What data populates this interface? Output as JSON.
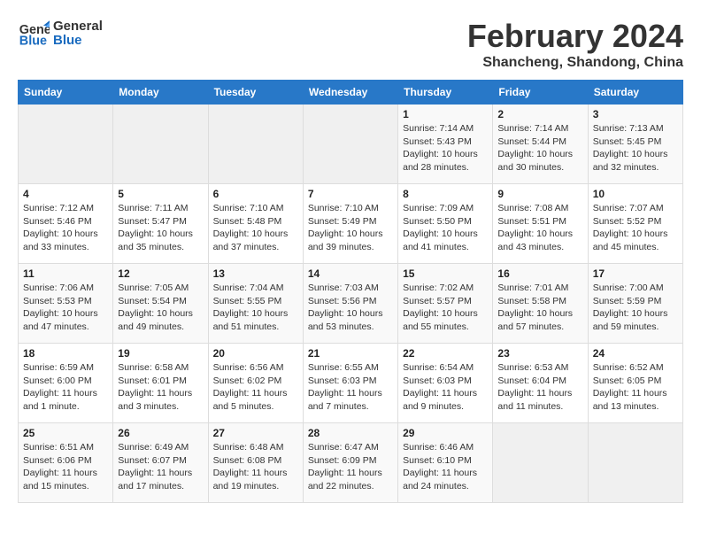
{
  "header": {
    "logo_line1": "General",
    "logo_line2": "Blue",
    "title": "February 2024",
    "subtitle": "Shancheng, Shandong, China"
  },
  "weekdays": [
    "Sunday",
    "Monday",
    "Tuesday",
    "Wednesday",
    "Thursday",
    "Friday",
    "Saturday"
  ],
  "weeks": [
    [
      {
        "day": "",
        "info": ""
      },
      {
        "day": "",
        "info": ""
      },
      {
        "day": "",
        "info": ""
      },
      {
        "day": "",
        "info": ""
      },
      {
        "day": "1",
        "info": "Sunrise: 7:14 AM\nSunset: 5:43 PM\nDaylight: 10 hours\nand 28 minutes."
      },
      {
        "day": "2",
        "info": "Sunrise: 7:14 AM\nSunset: 5:44 PM\nDaylight: 10 hours\nand 30 minutes."
      },
      {
        "day": "3",
        "info": "Sunrise: 7:13 AM\nSunset: 5:45 PM\nDaylight: 10 hours\nand 32 minutes."
      }
    ],
    [
      {
        "day": "4",
        "info": "Sunrise: 7:12 AM\nSunset: 5:46 PM\nDaylight: 10 hours\nand 33 minutes."
      },
      {
        "day": "5",
        "info": "Sunrise: 7:11 AM\nSunset: 5:47 PM\nDaylight: 10 hours\nand 35 minutes."
      },
      {
        "day": "6",
        "info": "Sunrise: 7:10 AM\nSunset: 5:48 PM\nDaylight: 10 hours\nand 37 minutes."
      },
      {
        "day": "7",
        "info": "Sunrise: 7:10 AM\nSunset: 5:49 PM\nDaylight: 10 hours\nand 39 minutes."
      },
      {
        "day": "8",
        "info": "Sunrise: 7:09 AM\nSunset: 5:50 PM\nDaylight: 10 hours\nand 41 minutes."
      },
      {
        "day": "9",
        "info": "Sunrise: 7:08 AM\nSunset: 5:51 PM\nDaylight: 10 hours\nand 43 minutes."
      },
      {
        "day": "10",
        "info": "Sunrise: 7:07 AM\nSunset: 5:52 PM\nDaylight: 10 hours\nand 45 minutes."
      }
    ],
    [
      {
        "day": "11",
        "info": "Sunrise: 7:06 AM\nSunset: 5:53 PM\nDaylight: 10 hours\nand 47 minutes."
      },
      {
        "day": "12",
        "info": "Sunrise: 7:05 AM\nSunset: 5:54 PM\nDaylight: 10 hours\nand 49 minutes."
      },
      {
        "day": "13",
        "info": "Sunrise: 7:04 AM\nSunset: 5:55 PM\nDaylight: 10 hours\nand 51 minutes."
      },
      {
        "day": "14",
        "info": "Sunrise: 7:03 AM\nSunset: 5:56 PM\nDaylight: 10 hours\nand 53 minutes."
      },
      {
        "day": "15",
        "info": "Sunrise: 7:02 AM\nSunset: 5:57 PM\nDaylight: 10 hours\nand 55 minutes."
      },
      {
        "day": "16",
        "info": "Sunrise: 7:01 AM\nSunset: 5:58 PM\nDaylight: 10 hours\nand 57 minutes."
      },
      {
        "day": "17",
        "info": "Sunrise: 7:00 AM\nSunset: 5:59 PM\nDaylight: 10 hours\nand 59 minutes."
      }
    ],
    [
      {
        "day": "18",
        "info": "Sunrise: 6:59 AM\nSunset: 6:00 PM\nDaylight: 11 hours\nand 1 minute."
      },
      {
        "day": "19",
        "info": "Sunrise: 6:58 AM\nSunset: 6:01 PM\nDaylight: 11 hours\nand 3 minutes."
      },
      {
        "day": "20",
        "info": "Sunrise: 6:56 AM\nSunset: 6:02 PM\nDaylight: 11 hours\nand 5 minutes."
      },
      {
        "day": "21",
        "info": "Sunrise: 6:55 AM\nSunset: 6:03 PM\nDaylight: 11 hours\nand 7 minutes."
      },
      {
        "day": "22",
        "info": "Sunrise: 6:54 AM\nSunset: 6:03 PM\nDaylight: 11 hours\nand 9 minutes."
      },
      {
        "day": "23",
        "info": "Sunrise: 6:53 AM\nSunset: 6:04 PM\nDaylight: 11 hours\nand 11 minutes."
      },
      {
        "day": "24",
        "info": "Sunrise: 6:52 AM\nSunset: 6:05 PM\nDaylight: 11 hours\nand 13 minutes."
      }
    ],
    [
      {
        "day": "25",
        "info": "Sunrise: 6:51 AM\nSunset: 6:06 PM\nDaylight: 11 hours\nand 15 minutes."
      },
      {
        "day": "26",
        "info": "Sunrise: 6:49 AM\nSunset: 6:07 PM\nDaylight: 11 hours\nand 17 minutes."
      },
      {
        "day": "27",
        "info": "Sunrise: 6:48 AM\nSunset: 6:08 PM\nDaylight: 11 hours\nand 19 minutes."
      },
      {
        "day": "28",
        "info": "Sunrise: 6:47 AM\nSunset: 6:09 PM\nDaylight: 11 hours\nand 22 minutes."
      },
      {
        "day": "29",
        "info": "Sunrise: 6:46 AM\nSunset: 6:10 PM\nDaylight: 11 hours\nand 24 minutes."
      },
      {
        "day": "",
        "info": ""
      },
      {
        "day": "",
        "info": ""
      }
    ]
  ]
}
